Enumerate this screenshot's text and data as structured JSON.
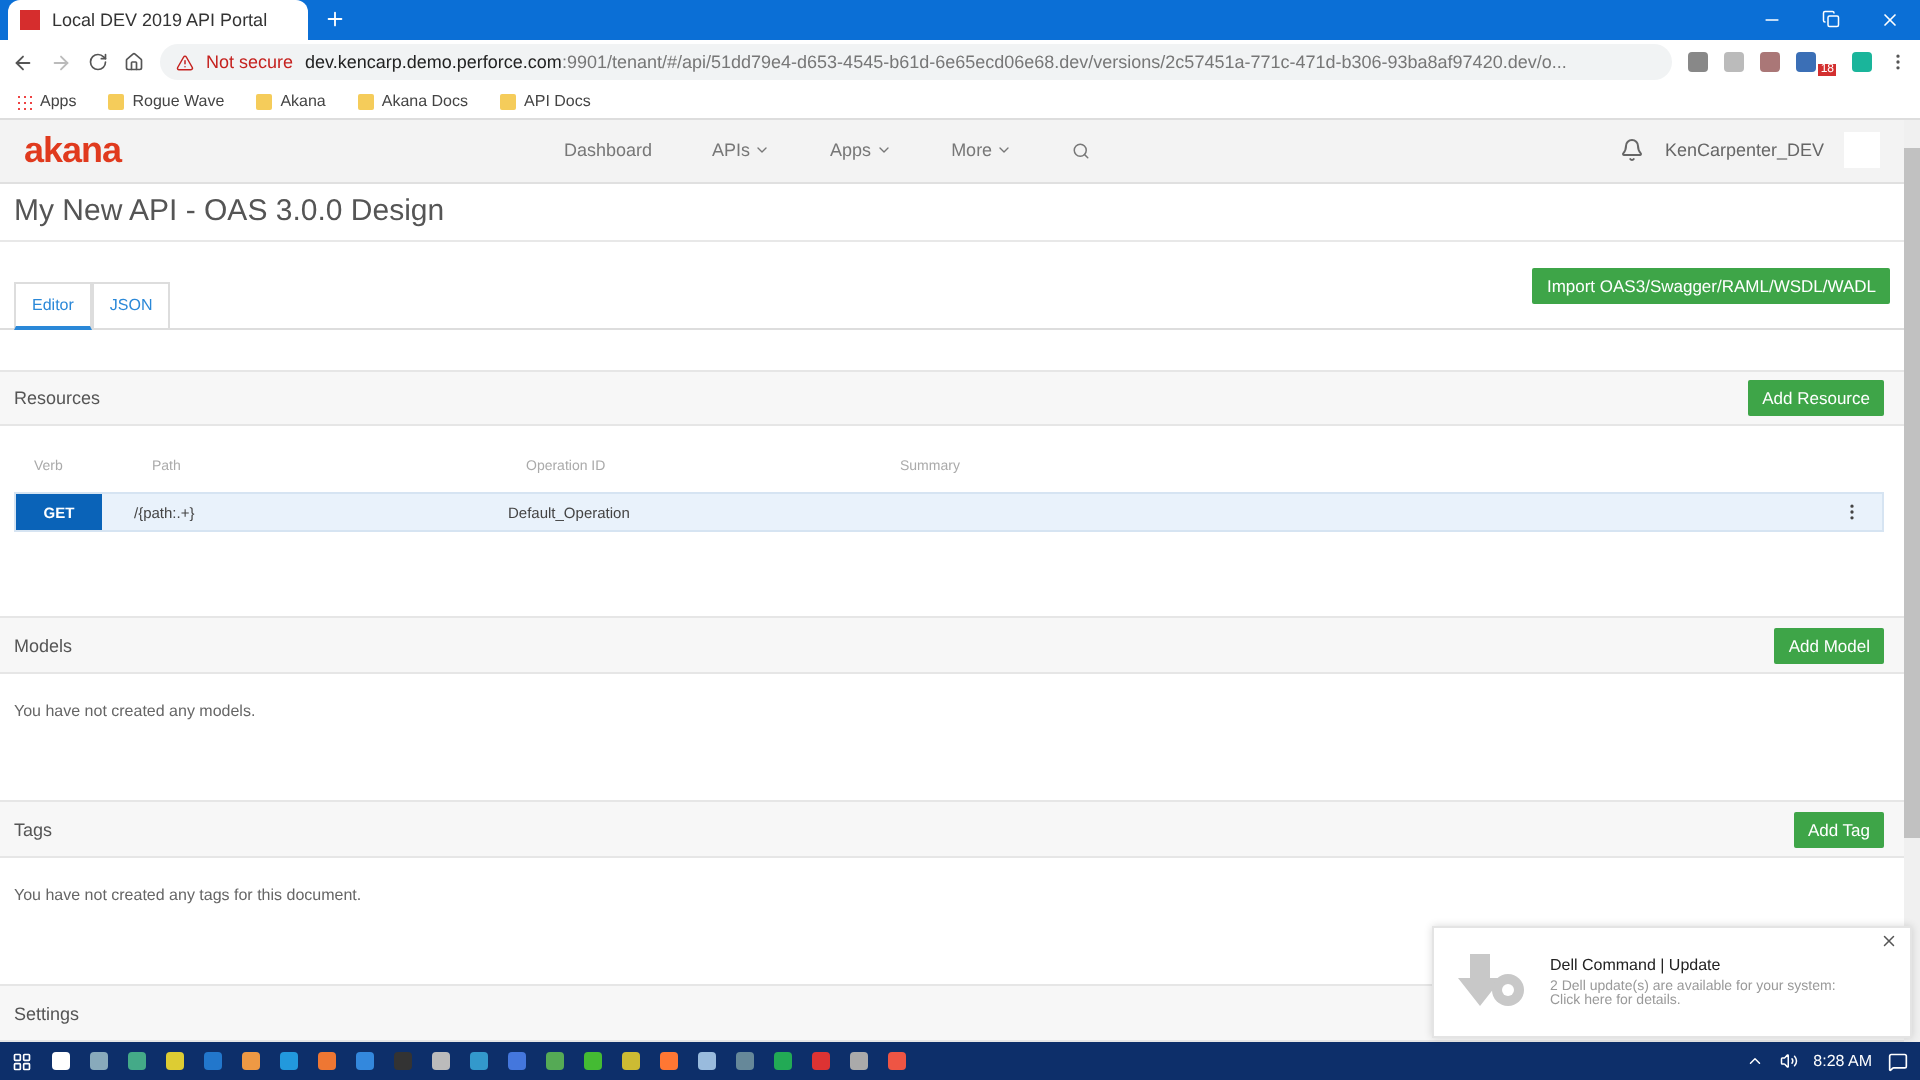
{
  "browser": {
    "tab_title": "Local DEV 2019 API Portal",
    "security": "Not secure",
    "url_host": "dev.kencarp.demo.perforce.com",
    "url_rest": ":9901/tenant/#/api/51dd79e4-d653-4545-b61d-6e65ecd06e68.dev/versions/2c57451a-771c-471d-b306-93ba8af97420.dev/o...",
    "extension_badge": "18",
    "bookmarks": [
      {
        "label": "Apps",
        "kind": "apps"
      },
      {
        "label": "Rogue Wave",
        "kind": "folder"
      },
      {
        "label": "Akana",
        "kind": "folder"
      },
      {
        "label": "Akana Docs",
        "kind": "folder"
      },
      {
        "label": "API Docs",
        "kind": "folder"
      }
    ]
  },
  "header": {
    "logo": "akana",
    "nav": [
      {
        "label": "Dashboard",
        "dropdown": false
      },
      {
        "label": "APIs",
        "dropdown": true
      },
      {
        "label": "Apps",
        "dropdown": true
      },
      {
        "label": "More",
        "dropdown": true
      }
    ],
    "user": "KenCarpenter_DEV"
  },
  "page_title": "My New API - OAS 3.0.0 Design",
  "import_button": "Import OAS3/Swagger/RAML/WSDL/WADL",
  "tabs": [
    {
      "label": "Editor",
      "selected": true
    },
    {
      "label": "JSON",
      "selected": false
    }
  ],
  "sections": [
    {
      "title": "Resources",
      "button": "Add Resource",
      "columns": [
        "Verb",
        "Path",
        "Operation ID",
        "Summary"
      ],
      "rows": [
        {
          "verb": "GET",
          "path": "/{path:.+}",
          "operation_id": "Default_Operation"
        }
      ]
    },
    {
      "title": "Models",
      "button": "Add Model",
      "empty_text": "You have not created any models."
    },
    {
      "title": "Tags",
      "button": "Add Tag",
      "empty_text": "You have not created any tags for this document."
    },
    {
      "title": "Settings"
    }
  ],
  "notification": {
    "title": "Dell Command | Update",
    "lines": [
      "2 Dell update(s) are available for your system:",
      "Click here for details."
    ]
  },
  "taskbar": {
    "time": "8:28 AM"
  }
}
